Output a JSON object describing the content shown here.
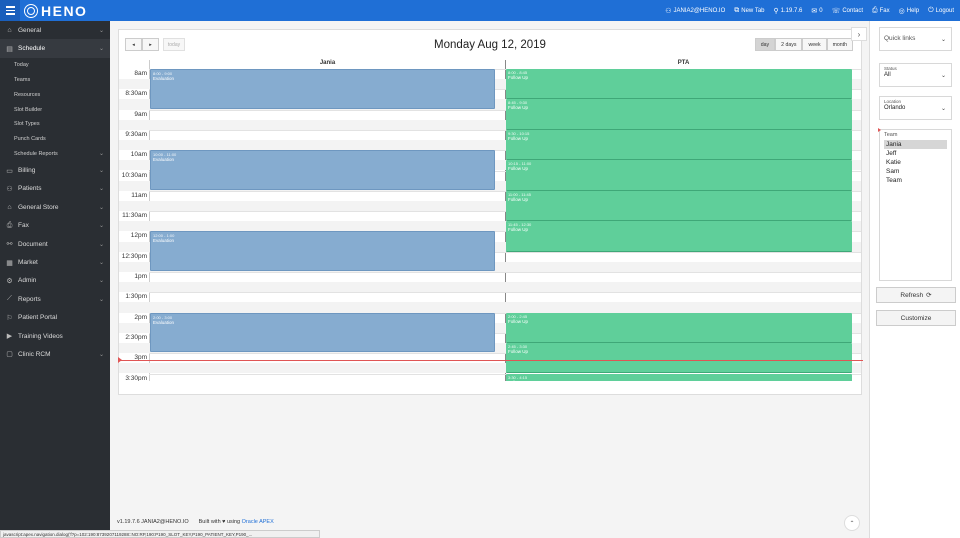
{
  "topbar": {
    "brand": "HENO",
    "user": "JANIA2@HENO.IO",
    "new_tab": "New Tab",
    "version": "1.19.7.6",
    "mail_count": "0",
    "contact": "Contact",
    "fax": "Fax",
    "help": "Help",
    "logout": "Logout"
  },
  "sidebar": {
    "items": [
      {
        "label": "General",
        "icon": "home-icon"
      },
      {
        "label": "Schedule",
        "icon": "calendar-icon"
      },
      {
        "label": "Billing",
        "icon": "billing-icon"
      },
      {
        "label": "Patients",
        "icon": "patients-icon"
      },
      {
        "label": "General Store",
        "icon": "store-icon"
      },
      {
        "label": "Fax",
        "icon": "fax-icon"
      },
      {
        "label": "Document",
        "icon": "document-icon"
      },
      {
        "label": "Market",
        "icon": "market-icon"
      },
      {
        "label": "Admin",
        "icon": "admin-icon"
      },
      {
        "label": "Reports",
        "icon": "reports-icon"
      },
      {
        "label": "Patient Portal",
        "icon": "portal-icon"
      },
      {
        "label": "Training Videos",
        "icon": "video-icon"
      },
      {
        "label": "Clinic RCM",
        "icon": "rcm-icon"
      }
    ],
    "schedule_sub": [
      "Today",
      "Teams",
      "Resources",
      "Slot Builder",
      "Slot Types",
      "Punch Cards",
      "Schedule Reports"
    ]
  },
  "calendar": {
    "title": "Monday Aug 12, 2019",
    "today_label": "today",
    "prev_label": "◂",
    "next_label": "▸",
    "views": [
      "day",
      "2 days",
      "week",
      "month"
    ],
    "active_view": "day",
    "resources": [
      "Jania",
      "PTA"
    ],
    "time_labels": [
      "8am",
      "8:30am",
      "9am",
      "9:30am",
      "10am",
      "10:30am",
      "11am",
      "11:30am",
      "12pm",
      "12:30pm",
      "1pm",
      "1:30pm",
      "2pm",
      "2:30pm",
      "3pm",
      "3:30pm"
    ],
    "jania_events": [
      {
        "time": "8:00 - 9:00",
        "title": "Evaluation"
      },
      {
        "time": "10:00 - 11:00",
        "title": "Evaluation"
      },
      {
        "time": "12:00 - 1:00",
        "title": "Evaluation"
      },
      {
        "time": "2:00 - 3:00",
        "title": "Evaluation"
      }
    ],
    "pta_events": [
      {
        "time": "8:00 - 8:45",
        "title": "Follow Up"
      },
      {
        "time": "8:45 - 9:30",
        "title": "Follow Up"
      },
      {
        "time": "9:30 - 10:15",
        "title": "Follow Up"
      },
      {
        "time": "10:15 - 11:00",
        "title": "Follow Up"
      },
      {
        "time": "11:00 - 11:45",
        "title": "Follow Up"
      },
      {
        "time": "11:45 - 12:30",
        "title": "Follow Up"
      },
      {
        "time": "2:00 - 2:45",
        "title": "Follow Up"
      },
      {
        "time": "2:45 - 3:30",
        "title": "Follow Up"
      },
      {
        "time": "3:30 - 4:15",
        "title": "Follow Up"
      }
    ]
  },
  "right_panel": {
    "quick_links": "Quick links",
    "status_label": "Status",
    "status_value": "All",
    "location_label": "Location",
    "location_value": "Orlando",
    "team_label": "Team",
    "team_members": [
      "Jania",
      "Jeff",
      "Katie",
      "Sam",
      "Team"
    ],
    "selected_member": "Jania",
    "refresh_label": "Refresh",
    "customize_label": "Customize"
  },
  "footer": {
    "version_user": "v1.19.7.6 JANIA2@HENO.IO",
    "built_with": "Built with",
    "using": "using",
    "apex_link": "Oracle APEX",
    "status_url": "javascript:apex.navigation.dialog('f?p=102:190:8739207119288::NO:RP,190:P190_SLOT_KEY,P190_PATIENT_KEY,P190_..."
  },
  "colors": {
    "topbar": "#1f6fd6",
    "sidebar": "#2a2e33",
    "event_blue": "#86acd0",
    "event_green": "#5fcf9a",
    "now_line": "#e05555"
  }
}
